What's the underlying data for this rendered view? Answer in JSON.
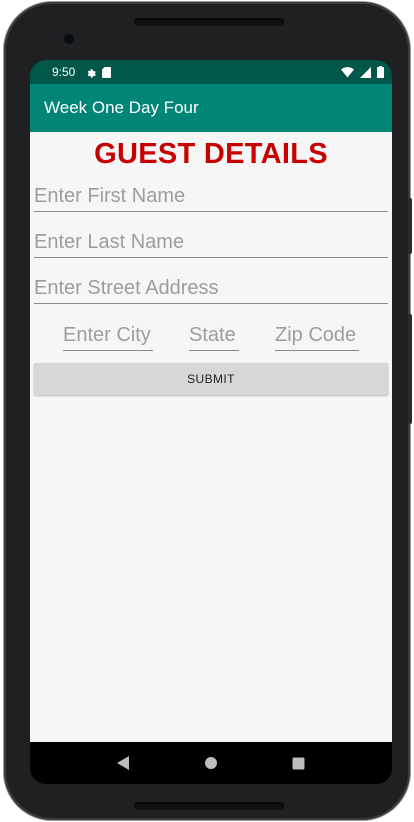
{
  "status_bar": {
    "time": "9:50",
    "icons": [
      "settings-icon",
      "sd-card-icon",
      "wifi-icon",
      "signal-icon",
      "battery-icon"
    ]
  },
  "app_bar": {
    "title": "Week One Day Four"
  },
  "form": {
    "heading": "GUEST DETAILS",
    "first_name": {
      "placeholder": "Enter First Name",
      "value": ""
    },
    "last_name": {
      "placeholder": "Enter Last Name",
      "value": ""
    },
    "street": {
      "placeholder": "Enter Street Address",
      "value": ""
    },
    "city": {
      "placeholder": "Enter City",
      "value": ""
    },
    "state": {
      "placeholder": "State",
      "value": ""
    },
    "zip": {
      "placeholder": "Zip Code",
      "value": ""
    },
    "submit_label": "SUBMIT"
  },
  "nav_bar": {
    "icons": [
      "back-icon",
      "home-icon",
      "recents-icon"
    ]
  },
  "colors": {
    "status_bar": "#00574a",
    "app_bar": "#008577",
    "heading": "#c70000",
    "background": "#f6f6f6",
    "button": "#d6d7d7"
  }
}
